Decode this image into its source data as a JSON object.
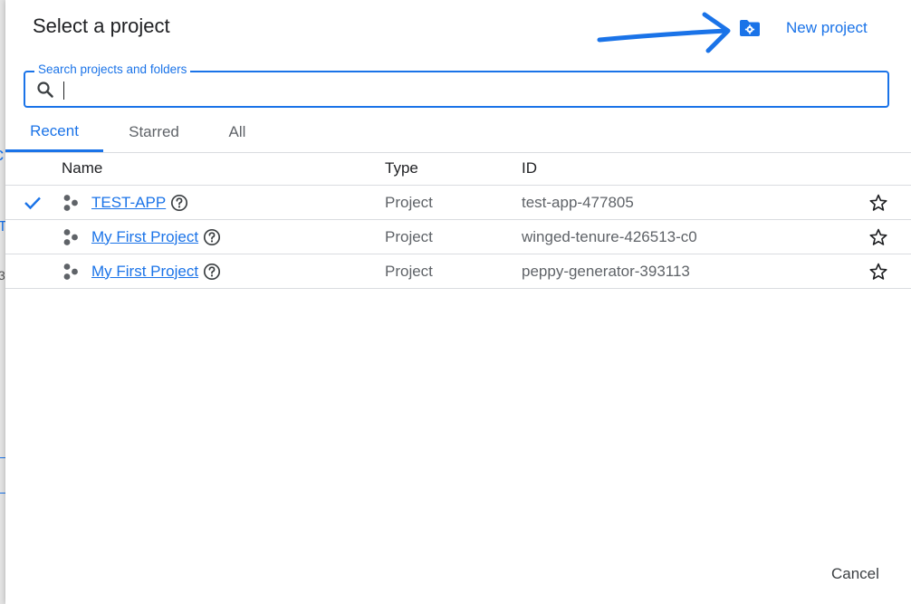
{
  "dialog": {
    "title": "Select a project",
    "new_project_label": "New project",
    "cancel_label": "Cancel"
  },
  "search": {
    "label": "Search projects and folders",
    "value": "",
    "placeholder": ""
  },
  "tabs": [
    {
      "label": "Recent",
      "active": true
    },
    {
      "label": "Starred",
      "active": false
    },
    {
      "label": "All",
      "active": false
    }
  ],
  "table": {
    "headers": {
      "name": "Name",
      "type": "Type",
      "id": "ID"
    },
    "rows": [
      {
        "name": "TEST-APP",
        "type": "Project",
        "id": "test-app-477805",
        "selected": true
      },
      {
        "name": "My First Project",
        "type": "Project",
        "id": "winged-tenure-426513-c0",
        "selected": false
      },
      {
        "name": "My First Project",
        "type": "Project",
        "id": "peppy-generator-393113",
        "selected": false
      }
    ]
  },
  "icons": {
    "new_project": "folder-gear-icon",
    "search": "search-icon",
    "selected": "checkmark-icon",
    "project": "project-nodes-icon",
    "help": "help-circle-icon",
    "star": "star-outline-icon",
    "annotation": "arrow-right-icon"
  },
  "colors": {
    "accent": "#1a73e8",
    "text_primary": "#202124",
    "text_secondary": "#5f6368",
    "divider": "#dadce0"
  }
}
